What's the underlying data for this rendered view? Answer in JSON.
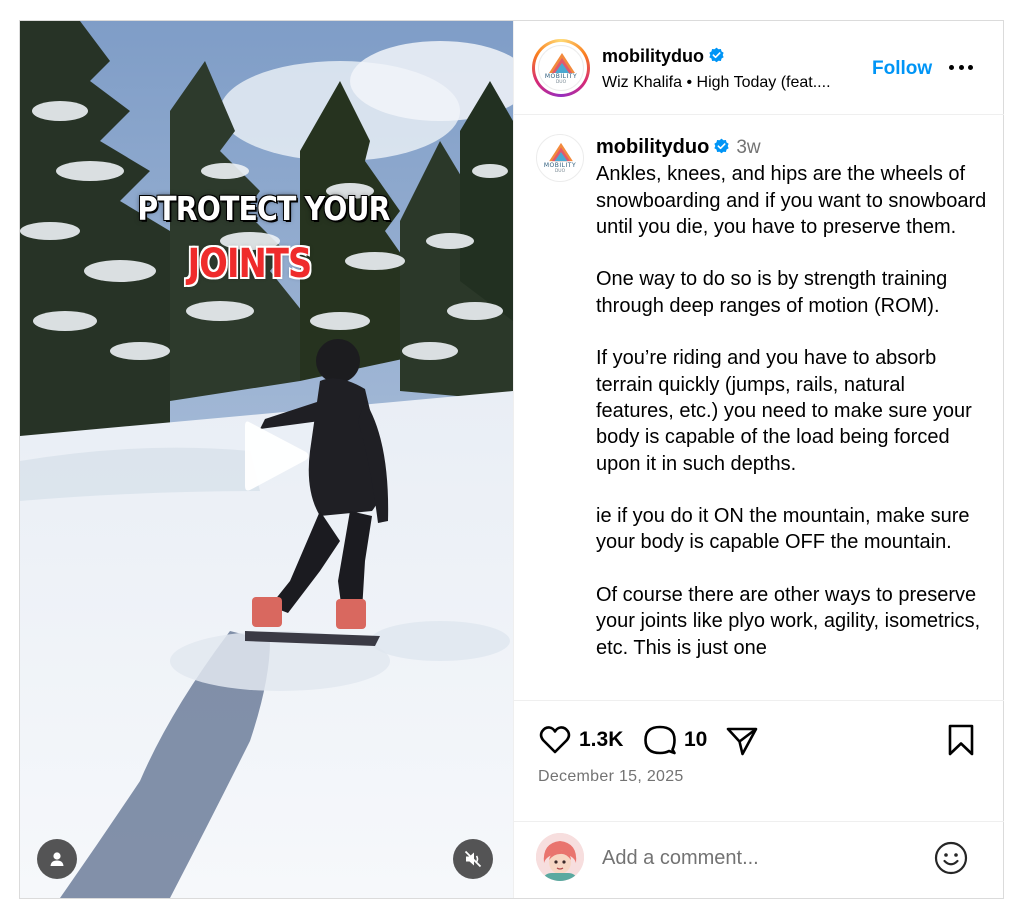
{
  "media": {
    "overlay_line1": "PTROTECT YOUR",
    "overlay_line2": "JOINTS",
    "play_icon": "play-icon",
    "tag_icon": "user-tag-icon",
    "mute_icon": "speaker-muted-icon"
  },
  "header": {
    "username": "mobilityduo",
    "verified": true,
    "audio": "Wiz Khalifa • High Today (feat....",
    "follow_label": "Follow",
    "more_icon": "more-options-icon",
    "logo_text": "MOBILITY",
    "logo_sub": "DUO"
  },
  "caption": {
    "username": "mobilityduo",
    "time": "3w",
    "paragraphs": [
      "Ankles, knees, and hips are the wheels of snowboarding and if you want to snowboard until you die, you have to preserve them.",
      "One way to do so is by strength training through deep ranges of motion (ROM).",
      "If you’re riding and you have to absorb terrain quickly (jumps, rails, natural features, etc.) you need to make sure your body is capable of the load being forced upon it in such depths.",
      "ie if you do it ON the mountain, make sure your body is capable OFF the mountain.",
      "Of course there are other ways to preserve your joints like plyo work, agility, isometrics, etc. This is just one"
    ]
  },
  "actions": {
    "like_count": "1.3K",
    "comment_count": "10",
    "date": "December 15, 2025"
  },
  "comment_box": {
    "placeholder": "Add a comment..."
  },
  "colors": {
    "accent": "#0095f6",
    "verified": "#0095f6",
    "overlay_red": "#ef2b2b",
    "muted_text": "#737373"
  }
}
